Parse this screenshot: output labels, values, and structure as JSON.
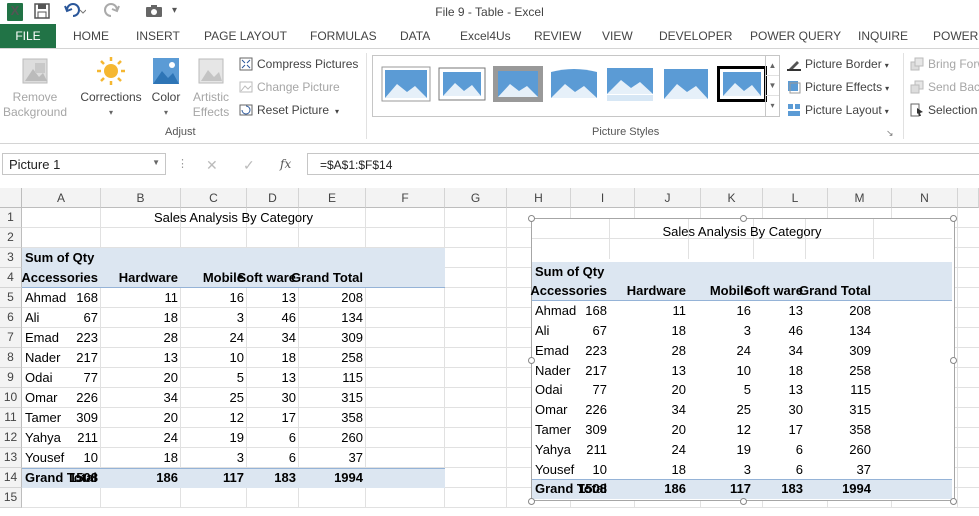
{
  "window": {
    "title": "File 9 - Table - Excel",
    "logo": "X"
  },
  "tabs": {
    "file": "FILE",
    "items": [
      "HOME",
      "INSERT",
      "PAGE LAYOUT",
      "FORMULAS",
      "DATA",
      "Excel4Us",
      "REVIEW",
      "VIEW",
      "DEVELOPER",
      "POWER QUERY",
      "INQUIRE",
      "POWERP"
    ]
  },
  "ribbon": {
    "remove_background": "Remove Background",
    "corrections": "Corrections",
    "color": "Color",
    "artistic_effects": "Artistic Effects",
    "compress_pictures": "Compress Pictures",
    "change_picture": "Change Picture",
    "reset_picture": "Reset Picture",
    "adjust_label": "Adjust",
    "picture_styles_label": "Picture Styles",
    "picture_border": "Picture Border",
    "picture_effects": "Picture Effects",
    "picture_layout": "Picture Layout",
    "bring_forward": "Bring Forw",
    "send_backward": "Send Back",
    "selection_pane": "Selection"
  },
  "formula_bar": {
    "name_box": "Picture 1",
    "fx": "fx",
    "formula": "=$A$1:$F$14"
  },
  "columns": [
    "A",
    "B",
    "C",
    "D",
    "E",
    "F",
    "G",
    "H",
    "I",
    "J",
    "K",
    "L",
    "M",
    "N"
  ],
  "rows": [
    "1",
    "2",
    "3",
    "4",
    "5",
    "6",
    "7",
    "8",
    "9",
    "10",
    "11",
    "12",
    "13",
    "14",
    "15"
  ],
  "table": {
    "title": "Sales Analysis By Category",
    "sum_label": "Sum of Qty",
    "headers": [
      "Accessories",
      "Hardware",
      "Mobile",
      "Soft ware",
      "Grand Total"
    ],
    "rows": [
      {
        "name": "Ahmad",
        "values": [
          "168",
          "11",
          "16",
          "13",
          "208"
        ]
      },
      {
        "name": "Ali",
        "values": [
          "67",
          "18",
          "3",
          "46",
          "134"
        ]
      },
      {
        "name": "Emad",
        "values": [
          "223",
          "28",
          "24",
          "34",
          "309"
        ]
      },
      {
        "name": "Nader",
        "values": [
          "217",
          "13",
          "10",
          "18",
          "258"
        ]
      },
      {
        "name": "Odai",
        "values": [
          "77",
          "20",
          "5",
          "13",
          "115"
        ]
      },
      {
        "name": "Omar",
        "values": [
          "226",
          "34",
          "25",
          "30",
          "315"
        ]
      },
      {
        "name": "Tamer",
        "values": [
          "309",
          "20",
          "12",
          "17",
          "358"
        ]
      },
      {
        "name": "Yahya",
        "values": [
          "211",
          "24",
          "19",
          "6",
          "260"
        ]
      },
      {
        "name": "Yousef",
        "values": [
          "10",
          "18",
          "3",
          "6",
          "37"
        ]
      }
    ],
    "total": {
      "name": "Grand Total",
      "values": [
        "1508",
        "186",
        "117",
        "183",
        "1994"
      ]
    }
  }
}
